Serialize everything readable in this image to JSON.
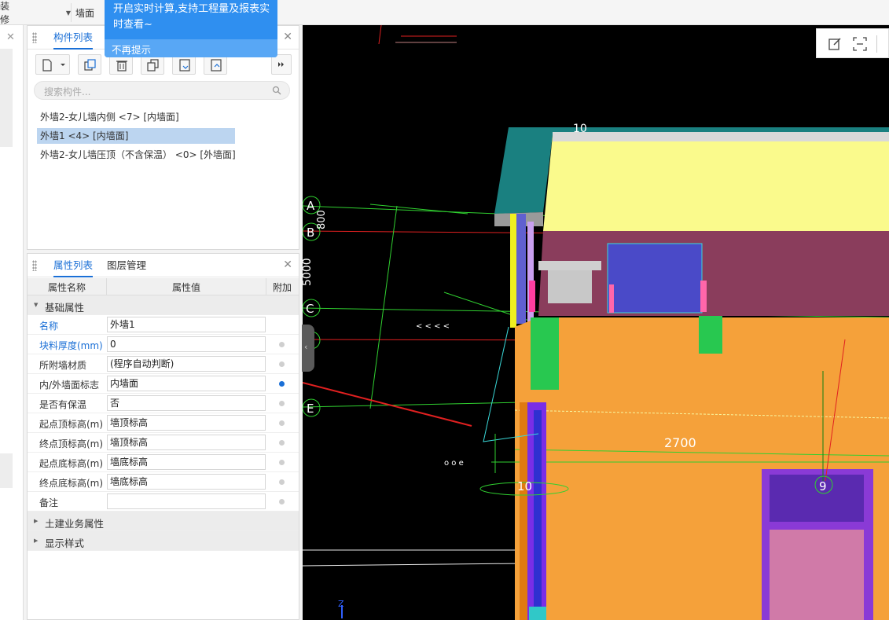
{
  "toolbar": {
    "scope_label": "装修",
    "type_label": "墙面"
  },
  "tooltip": {
    "message": "开启实时计算,支持工程量及报表实时查看~",
    "dismiss": "不再提示"
  },
  "component_panel": {
    "tab": "构件列表",
    "search_placeholder": "搜索构件...",
    "items": [
      "外墙2-女儿墙内侧 <7> [内墙面]",
      "外墙1 <4> [内墙面]",
      "外墙2-女儿墙压顶（不含保温） <0> [外墙面]"
    ],
    "selected_index": 1
  },
  "property_panel": {
    "tabs": [
      "属性列表",
      "图层管理"
    ],
    "headers": {
      "name": "属性名称",
      "value": "属性值",
      "extra": "附加"
    },
    "group_basic": "基础属性",
    "rows": [
      {
        "name": "名称",
        "value": "外墙1",
        "blue": true,
        "dot": "none"
      },
      {
        "name": "块料厚度(mm)",
        "value": "0",
        "blue": true,
        "dot": "off"
      },
      {
        "name": "所附墙材质",
        "value": "(程序自动判断)",
        "blue": false,
        "dot": "off"
      },
      {
        "name": "内/外墙面标志",
        "value": "内墙面",
        "blue": false,
        "dot": "on"
      },
      {
        "name": "是否有保温",
        "value": "否",
        "blue": false,
        "dot": "off"
      },
      {
        "name": "起点顶标高(m)",
        "value": "墙顶标高",
        "blue": false,
        "dot": "off"
      },
      {
        "name": "终点顶标高(m)",
        "value": "墙顶标高",
        "blue": false,
        "dot": "off"
      },
      {
        "name": "起点底标高(m)",
        "value": "墙底标高",
        "blue": false,
        "dot": "off"
      },
      {
        "name": "终点底标高(m)",
        "value": "墙底标高",
        "blue": false,
        "dot": "off"
      },
      {
        "name": "备注",
        "value": "",
        "blue": false,
        "dot": "off"
      }
    ],
    "group_civil": "土建业务属性",
    "group_display": "显示样式"
  },
  "viewport": {
    "axis_labels": [
      "A",
      "B",
      "C",
      "E"
    ],
    "dim_labels": [
      "2700",
      "10",
      "9",
      "5000",
      "800",
      "10"
    ],
    "axis_z": "Z"
  },
  "colors": {
    "accent": "#1a6fd6",
    "tooltip_bg": "#2f8ff0",
    "wall_orange": "#f5a13a",
    "ceiling_yellow": "#fafa8c",
    "roof_teal": "#1a8080"
  }
}
